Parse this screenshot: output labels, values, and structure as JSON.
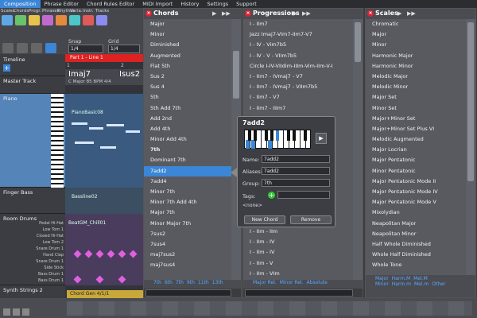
{
  "menu": [
    "Composition",
    "Phrase Editor",
    "Chord Rules Editor",
    "MIDI Import",
    "History",
    "Settings",
    "Support"
  ],
  "toolbar": {
    "icon_labels": [
      "Scales",
      "Chords",
      "Progr.",
      "Phrases",
      "Rhythm",
      "Varia.",
      "Instr.",
      "Tracks"
    ],
    "snap_label": "Snap",
    "snap_value": "1/4",
    "grid_label": "Grid",
    "grid_value": "1/4",
    "part_label": "Part 1 - Line 1"
  },
  "timeline": {
    "label": "Timeline",
    "ruler": [
      "1",
      "2"
    ],
    "chord1": "Imaj7",
    "chord2": "Isus2",
    "info": "C Major  85 BPM  4/4"
  },
  "tracks": [
    {
      "name": "Master Track"
    },
    {
      "name": "Piano",
      "clip": "PianoBasic08"
    },
    {
      "name": "Finger Bass",
      "clip": "Bassline02"
    },
    {
      "name": "Room Drums",
      "clip": "BeatGM_Chill01",
      "drum_rows": [
        "Pedal Hi-Hat",
        "Low Tom 1",
        "Closed Hi-Hat",
        "Low Tom 2",
        "Snare Drum 1",
        "Hand Clap",
        "Snare Drum 1",
        "Side Stick",
        "Bass Drum 1",
        "Bass Drum 1"
      ]
    },
    {
      "name": "Synth Strings 2",
      "clip": "Chord Gen 4/1/1"
    }
  ],
  "chords": {
    "title": "Chords",
    "items": [
      "Major",
      "Minor",
      "Diminished",
      "Augmented",
      "Flat 5th",
      "Sus 2",
      "Sus 4",
      "5th",
      "5th Add 7th",
      "Add 2nd",
      "Add 4th",
      "Minor Add 4th"
    ],
    "section": "7th",
    "items2": [
      "Dominant 7th",
      "7add2",
      "7add4",
      "Minor 7th",
      "Minor 7th Add 4th",
      "Major 7th",
      "Minor Major 7th",
      "7sus2",
      "7sus4",
      "maj7sus2",
      "maj7sus4"
    ],
    "selected": "7add2",
    "footer": [
      "7th",
      "6th",
      "7th",
      "9th",
      "11th",
      "13th"
    ]
  },
  "progressions": {
    "title": "Progressions",
    "items": [
      "I - IIm7",
      "Jazz Imaj7-Vim7-IIm7-V7",
      "I - IV - Vim7b5",
      "I - IV - V - VIIm7b5",
      "Circle I-IV-VIIdim-IIIm-Vim-IIm-V-I",
      "I - IIm7 - IVmaj7 - V7",
      "I - IIm7 - IVmaj7 - VIIm7b5",
      "I - IIm7 - V7",
      "I - IIm7 - IIIm7",
      "I - IIm7 - V"
    ],
    "items2": [
      "I - IIm",
      "I - IIm - IIm",
      "I - IIm - IV",
      "I - IIm - IV",
      "I - IIm - V",
      "I - IIm - VIm",
      "I - IIm - VIm"
    ],
    "footer": [
      "Major Rel.",
      "Minor Rel.",
      "Absolute"
    ]
  },
  "scales": {
    "title": "Scales",
    "items": [
      "Chromatic",
      "Major",
      "Minor",
      "Harmonic Major",
      "Harmonic Minor",
      "Melodic Major",
      "Melodic Minor",
      "Major Set",
      "Minor Set",
      "Major+Minor Set",
      "Major+Minor Set Plus VI",
      "Melodic Augmented",
      "Major Locrian",
      "Major Pentatonic",
      "Minor Pentatonic",
      "Major Pentatonic Mode II",
      "Major Pentatonic Mode IV",
      "Major Pentatonic Mode V",
      "Mixolydian",
      "Neapolitan Major",
      "Neapolitan Minor",
      "Half Whole Diminished",
      "Whole Half Diminished",
      "Whole Tone"
    ],
    "footer_row1": [
      "Major",
      "Harm.M",
      "Mel.M"
    ],
    "footer_row2": [
      "Minor",
      "Harm.m",
      "Mel.m",
      "Other"
    ]
  },
  "popup": {
    "title": "7add2",
    "name_label": "Name:",
    "name_value": "7add2",
    "aliases_label": "Aliases:",
    "aliases_value": "7add2",
    "group_label": "Group:",
    "group_value": "7th",
    "tags_label": "Tags:",
    "tags_value": "<none>",
    "new_button": "New Chord",
    "remove_button": "Remove"
  },
  "colors": {
    "accent": "#3b86d6",
    "panel_list": "#585a60",
    "close": "#dd2233"
  }
}
